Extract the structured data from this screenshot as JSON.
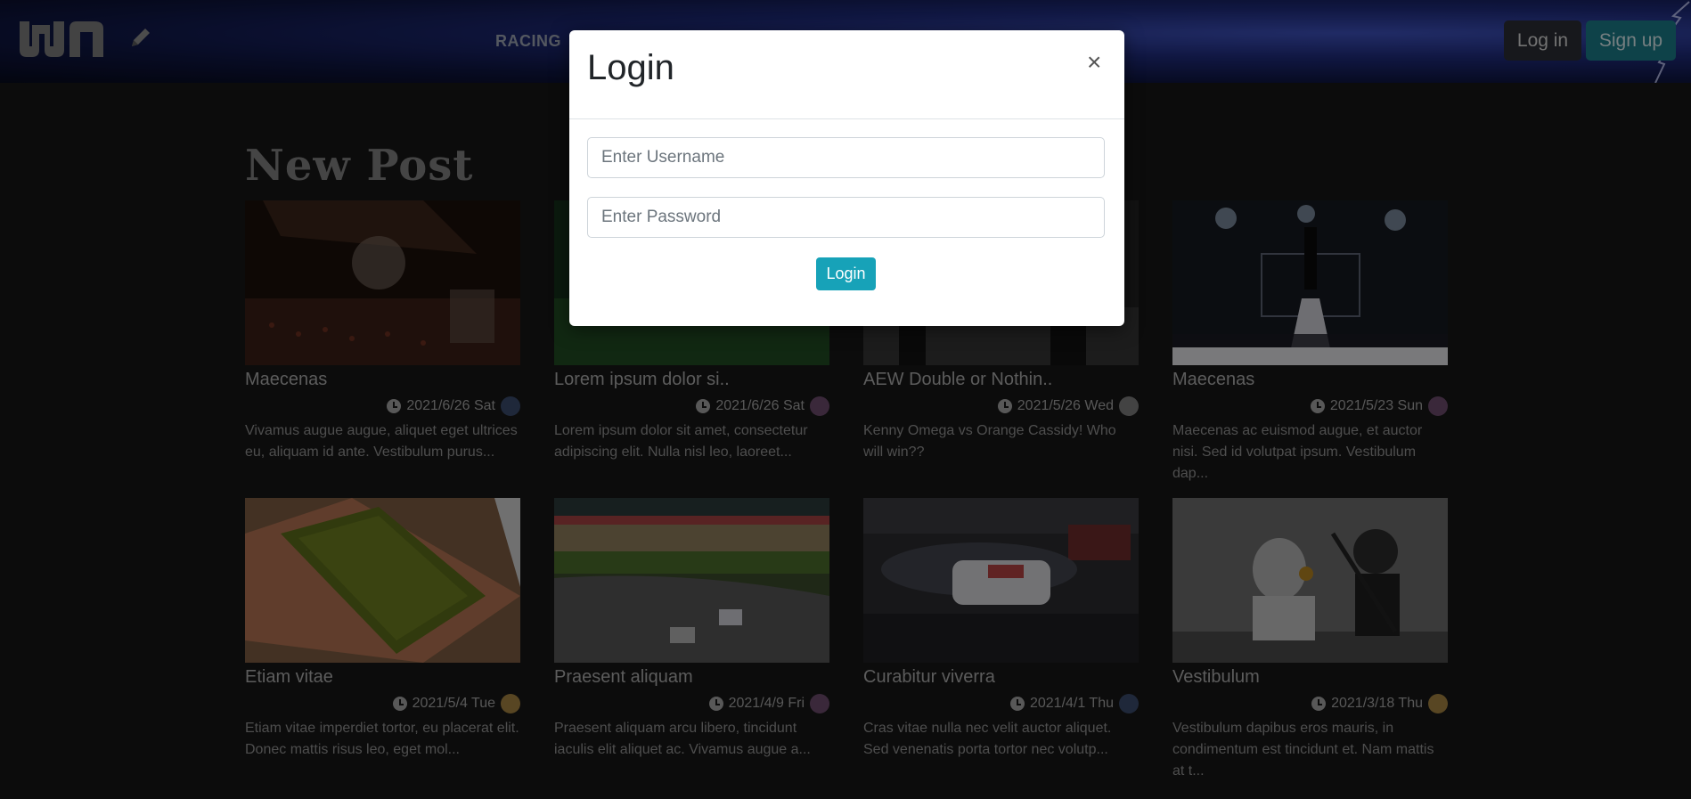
{
  "header": {
    "nav_item": "RACING",
    "login_label": "Log in",
    "signup_label": "Sign up"
  },
  "section": {
    "title": "New Post"
  },
  "posts": [
    {
      "title": "Maecenas",
      "date": "2021/6/26 Sat",
      "desc": "Vivamus augue augue, aliquet eget ultrices eu, aliquam id ante. Vestibulum purus..."
    },
    {
      "title": "Lorem ipsum dolor si..",
      "date": "2021/6/26 Sat",
      "desc": "Lorem ipsum dolor sit amet, consectetur adipiscing elit. Nulla nisl leo, laoreet..."
    },
    {
      "title": "AEW Double or Nothin..",
      "date": "2021/5/26 Wed",
      "desc": "Kenny Omega vs Orange Cassidy! Who will win??"
    },
    {
      "title": "Maecenas",
      "date": "2021/5/23 Sun",
      "desc": "Maecenas ac euismod augue, et auctor nisi. Sed id volutpat ipsum. Vestibulum dap..."
    },
    {
      "title": "Etiam vitae",
      "date": "2021/5/4 Tue",
      "desc": "Etiam vitae imperdiet tortor, eu placerat elit. Donec mattis risus leo, eget mol..."
    },
    {
      "title": "Praesent aliquam",
      "date": "2021/4/9 Fri",
      "desc": "Praesent aliquam arcu libero, tincidunt iaculis elit aliquet ac. Vivamus augue a..."
    },
    {
      "title": "Curabitur viverra",
      "date": "2021/4/1 Thu",
      "desc": "Cras vitae nulla nec velit auctor aliquet. Sed venenatis porta tortor nec volutp..."
    },
    {
      "title": "Vestibulum",
      "date": "2021/3/18 Thu",
      "desc": "Vestibulum dapibus eros mauris, in condimentum est tincidunt et. Nam mattis at t..."
    }
  ],
  "modal": {
    "title": "Login",
    "close_symbol": "×",
    "username_placeholder": "Enter Username",
    "password_placeholder": "Enter Password",
    "submit_label": "Login"
  },
  "colors": {
    "accent": "#17a2b8",
    "signup_bg": "#1b7885",
    "page_bg": "#161616"
  }
}
